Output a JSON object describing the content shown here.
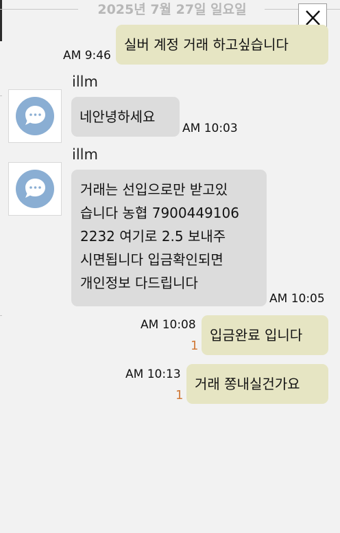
{
  "chat": {
    "date_divider": "2025년 7월 27일 일요일",
    "close_icon": "close-icon",
    "messages": [
      {
        "direction": "outgoing",
        "text": "실버 계정 거래 하고싶습니다",
        "time": "AM 9:46"
      },
      {
        "direction": "incoming",
        "sender": "illm",
        "avatar_icon": "speech-bubble-icon",
        "text": "네안녕하세요",
        "time": "AM 10:03"
      },
      {
        "direction": "incoming",
        "sender": "illm",
        "avatar_icon": "speech-bubble-icon",
        "lines": [
          "거래는 선입으로만 받고있",
          "습니다 농협 7900449106",
          "2232 여기로 2.5 보내주",
          "시면됩니다 입금확인되면",
          "개인정보 다드립니다"
        ],
        "time": "AM 10:05"
      },
      {
        "direction": "outgoing",
        "text": "입금완료 입니다",
        "time": "AM 10:08",
        "unread": "1"
      },
      {
        "direction": "outgoing",
        "text": "거래 쫑내실건가요",
        "time": "AM 10:13",
        "unread": "1"
      }
    ]
  },
  "colors": {
    "outgoing_bubble": "#e6e5c3",
    "incoming_bubble": "#dcdcdc",
    "background": "#f2f2f2",
    "unread_count": "#d07a38",
    "avatar_icon": "#8aaed3",
    "date_text": "#b7b7b7"
  }
}
